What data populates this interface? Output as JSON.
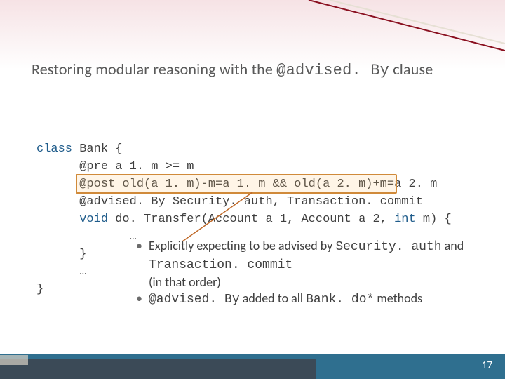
{
  "title": {
    "pre": "Restoring modular reasoning with the ",
    "mono": "@advised. By",
    "post": " clause"
  },
  "code": {
    "l1a": "class",
    "l1b": " Bank {",
    "l2": "      @pre a 1. m >= m",
    "l3": "      @post old(a 1. m)-m=a 1. m && old(a 2. m)+m=a 2. m",
    "l4": "      @advised. By Security. auth, Transaction. commit",
    "l5a": "      ",
    "l5b": "void",
    "l5c": " do. Transfer(Account a 1, Account a 2, ",
    "l5d": "int",
    "l5e": " m) {",
    "l6": "             …",
    "l7": "      }",
    "l8": "      …",
    "l9": "}"
  },
  "bullets": {
    "b1a": "Explicitly expecting to be advised by ",
    "b1m1": "Security. auth",
    "b1mid": " and ",
    "b1m2": "Transaction. commit",
    "b1b": " (in that order)",
    "b2m1": "@advised. By",
    "b2mid": " added to all ",
    "b2m2": "Bank. do*",
    "b2end": " methods"
  },
  "page": "17"
}
